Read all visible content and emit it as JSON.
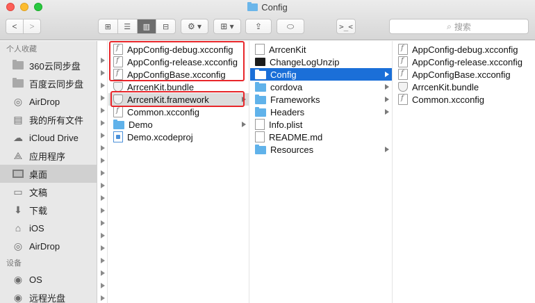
{
  "window": {
    "title": "Config"
  },
  "toolbar": {
    "back_label": "<",
    "forward_label": ">",
    "view_icons_label": "⊞",
    "view_list_label": "☰",
    "view_columns_label": "▥",
    "view_coverflow_label": "⊟",
    "action_label": "⚙ ▾",
    "arrange_label": "⊞ ▾",
    "share_label": "⇪",
    "tag_label": "⬭",
    "terminal_label": ">_<",
    "search_placeholder": "搜索"
  },
  "sidebar": {
    "favorites_header": "个人收藏",
    "favorites": [
      {
        "label": "360云同步盘",
        "icon": "folder-icon"
      },
      {
        "label": "百度云同步盘",
        "icon": "folder-icon"
      },
      {
        "label": "AirDrop",
        "icon": "airdrop-icon"
      },
      {
        "label": "我的所有文件",
        "icon": "all-files-icon"
      },
      {
        "label": "iCloud Drive",
        "icon": "cloud-icon"
      },
      {
        "label": "应用程序",
        "icon": "applications-icon"
      },
      {
        "label": "桌面",
        "icon": "desktop-icon"
      },
      {
        "label": "文稿",
        "icon": "documents-icon"
      },
      {
        "label": "下载",
        "icon": "download-icon"
      },
      {
        "label": "iOS",
        "icon": "home-icon"
      },
      {
        "label": "AirDrop",
        "icon": "airdrop-icon"
      }
    ],
    "devices_header": "设备",
    "devices": [
      {
        "label": "OS",
        "icon": "disk-icon"
      },
      {
        "label": "远程光盘",
        "icon": "disc-icon"
      }
    ],
    "active_index": 6
  },
  "columns": {
    "col1": [
      {
        "name": "AppConfig-debug.xcconfig",
        "icon": "xcconfig-file-icon"
      },
      {
        "name": "AppConfig-release.xcconfig",
        "icon": "xcconfig-file-icon"
      },
      {
        "name": "AppConfigBase.xcconfig",
        "icon": "xcconfig-file-icon"
      },
      {
        "name": "ArrcenKit.bundle",
        "icon": "bundle-icon"
      },
      {
        "name": "ArrcenKit.framework",
        "icon": "framework-icon"
      },
      {
        "name": "Common.xcconfig",
        "icon": "xcconfig-file-icon"
      },
      {
        "name": "Demo",
        "icon": "folder-icon"
      },
      {
        "name": "Demo.xcodeproj",
        "icon": "xcodeproj-icon"
      }
    ],
    "col2": [
      {
        "name": "ArrcenKit",
        "icon": "file-icon"
      },
      {
        "name": "ChangeLogUnzip",
        "icon": "executable-icon"
      },
      {
        "name": "Config",
        "icon": "folder-icon"
      },
      {
        "name": "cordova",
        "icon": "folder-icon"
      },
      {
        "name": "Frameworks",
        "icon": "folder-icon"
      },
      {
        "name": "Headers",
        "icon": "folder-icon"
      },
      {
        "name": "Info.plist",
        "icon": "plist-file-icon"
      },
      {
        "name": "README.md",
        "icon": "file-icon"
      },
      {
        "name": "Resources",
        "icon": "folder-icon"
      }
    ],
    "col3": [
      {
        "name": "AppConfig-debug.xcconfig",
        "icon": "xcconfig-file-icon"
      },
      {
        "name": "AppConfig-release.xcconfig",
        "icon": "xcconfig-file-icon"
      },
      {
        "name": "AppConfigBase.xcconfig",
        "icon": "xcconfig-file-icon"
      },
      {
        "name": "ArrcenKit.bundle",
        "icon": "bundle-icon"
      },
      {
        "name": "Common.xcconfig",
        "icon": "xcconfig-file-icon"
      }
    ]
  },
  "colors": {
    "selection": "#1b6fd8",
    "annotation": "#e8262a",
    "folder": "#60b2ea"
  }
}
